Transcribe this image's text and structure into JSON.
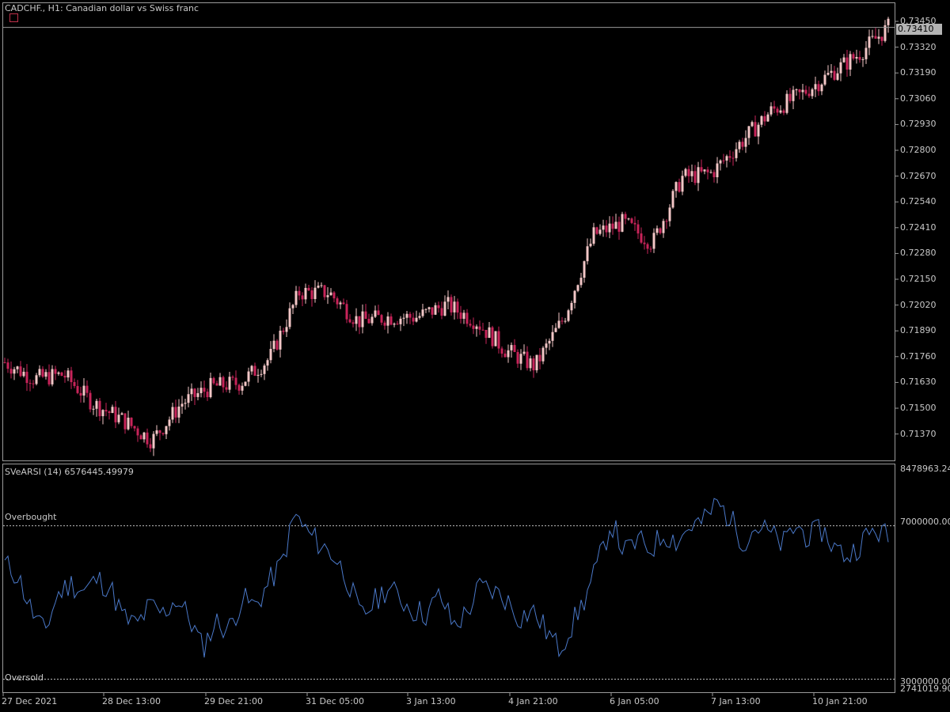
{
  "chart_title": "CADCHF., H1:  Canadian dollar vs Swiss franc",
  "price_scale": [
    "0.73450",
    "0.73320",
    "0.73190",
    "0.73060",
    "0.72930",
    "0.72800",
    "0.72670",
    "0.72540",
    "0.72410",
    "0.72280",
    "0.72150",
    "0.72020",
    "0.71890",
    "0.71760",
    "0.71630",
    "0.71500",
    "0.71370"
  ],
  "current_price": "0.73410",
  "indicator": {
    "title": "SVeARSI (14) 6576445.49979",
    "overbought_label": "Overbought",
    "oversold_label": "Oversold",
    "scale": [
      "8478963.24",
      "7000000.00",
      "3000000.00",
      "2741019.90"
    ]
  },
  "time_axis": [
    "27 Dec 2021",
    "28 Dec 13:00",
    "29 Dec 21:00",
    "31 Dec 05:00",
    "3 Jan 13:00",
    "4 Jan 21:00",
    "6 Jan 05:00",
    "7 Jan 13:00",
    "10 Jan 21:00"
  ],
  "colors": {
    "bull": "#f2c6c6",
    "bear": "#c8245a",
    "line": "#4a78c8",
    "grid": "#9a9a9a"
  },
  "chart_data": [
    {
      "type": "candlestick",
      "title": "CADCHF., H1:  Canadian dollar vs Swiss franc",
      "ylim": [
        0.7131,
        0.7352
      ],
      "x": [
        "27 Dec 2021",
        "28 Dec 13:00",
        "29 Dec 21:00",
        "31 Dec 05:00",
        "3 Jan 13:00",
        "4 Jan 21:00",
        "6 Jan 05:00",
        "7 Jan 13:00",
        "10 Jan 21:00"
      ],
      "close_trend": [
        0.7178,
        0.717,
        0.7172,
        0.7158,
        0.715,
        0.714,
        0.7158,
        0.7166,
        0.7168,
        0.718,
        0.7212,
        0.7212,
        0.7198,
        0.72,
        0.72,
        0.7206,
        0.7198,
        0.7184,
        0.7176,
        0.72,
        0.724,
        0.7246,
        0.7236,
        0.7268,
        0.727,
        0.7285,
        0.73,
        0.7308,
        0.7318,
        0.7328,
        0.7341
      ],
      "last": 0.7341
    },
    {
      "type": "line",
      "title": "SVeARSI (14) 6576445.49979",
      "ylim": [
        2741019.9,
        8478963.24
      ],
      "levels": {
        "overbought": 7000000,
        "oversold": 3000000
      },
      "values": [
        6000000,
        5700000,
        4800000,
        4200000,
        5200000,
        5500000,
        5300000,
        5600000,
        5400000,
        4600000,
        4400000,
        4900000,
        4700000,
        5100000,
        4600000,
        3800000,
        4500000,
        4300000,
        5100000,
        4900000,
        5500000,
        6000000,
        7300000,
        6800000,
        6500000,
        6200000,
        5600000,
        4600000,
        5000000,
        5400000,
        5100000,
        4800000,
        4700000,
        5200000,
        4400000,
        4700000,
        5400000,
        5300000,
        5100000,
        4600000,
        4800000,
        4300000,
        3800000,
        4400000,
        5100000,
        6000000,
        7100000,
        6300000,
        6600000,
        6400000,
        6800000,
        6600000,
        7000000,
        7100000,
        7600000,
        7200000,
        6600000,
        7000000,
        6800000,
        6500000,
        7000000,
        6700000,
        6900000,
        6400000,
        6200000,
        6600000,
        6900000,
        6700000
      ]
    }
  ]
}
